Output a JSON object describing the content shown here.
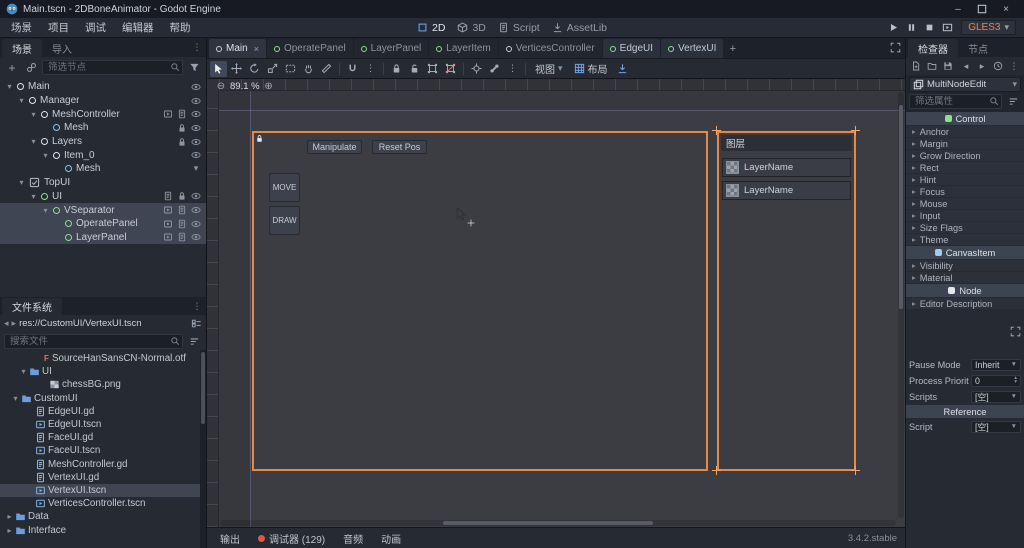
{
  "window": {
    "title": "Main.tscn - 2DBoneAnimator - Godot Engine"
  },
  "menubar": {
    "menus": [
      "场景",
      "项目",
      "调试",
      "编辑器",
      "帮助"
    ],
    "workspaces": [
      {
        "label": "2D",
        "active": true
      },
      {
        "label": "3D",
        "active": false
      },
      {
        "label": "Script",
        "active": false
      },
      {
        "label": "AssetLib",
        "active": false
      }
    ],
    "renderer": "GLES3"
  },
  "scene_dock": {
    "tabs": [
      {
        "label": "场景",
        "active": true
      },
      {
        "label": "导入",
        "active": false
      }
    ],
    "filter_placeholder": "筛选节点",
    "nodes": [
      {
        "name": "Main",
        "indent": 0,
        "arrow": true,
        "icon": "node",
        "color": "#dfe3e8",
        "buttons": [
          "eye"
        ],
        "selected": false
      },
      {
        "name": "Manager",
        "indent": 1,
        "arrow": true,
        "icon": "node",
        "color": "#dfe3e8",
        "buttons": [
          "eye"
        ],
        "selected": false
      },
      {
        "name": "MeshController",
        "indent": 2,
        "arrow": true,
        "icon": "node",
        "color": "#dfe3e8",
        "buttons": [
          "scene",
          "script",
          "eye"
        ],
        "selected": false
      },
      {
        "name": "Mesh",
        "indent": 3,
        "arrow": false,
        "icon": "node",
        "color": "#7fc7f0",
        "buttons": [
          "lock",
          "eye"
        ],
        "selected": false
      },
      {
        "name": "Layers",
        "indent": 2,
        "arrow": true,
        "icon": "node",
        "color": "#dfe3e8",
        "buttons": [
          "lock",
          "eye"
        ],
        "selected": false
      },
      {
        "name": "Item_0",
        "indent": 3,
        "arrow": true,
        "icon": "node",
        "color": "#dfe3e8",
        "buttons": [
          "eye"
        ],
        "selected": false
      },
      {
        "name": "Mesh",
        "indent": 4,
        "arrow": false,
        "icon": "node",
        "color": "#7fc7f0",
        "buttons": [
          "chev-down"
        ],
        "selected": false
      },
      {
        "name": "TopUI",
        "indent": 1,
        "arrow": true,
        "icon": "checkbox",
        "color": "#b9c0cb",
        "buttons": [],
        "selected": false
      },
      {
        "name": "UI",
        "indent": 2,
        "arrow": true,
        "icon": "node",
        "color": "#8ede8e",
        "buttons": [
          "script",
          "lock",
          "eye"
        ],
        "selected": false
      },
      {
        "name": "VSeparator",
        "indent": 3,
        "arrow": true,
        "icon": "node",
        "color": "#8ede8e",
        "buttons": [
          "scene",
          "script",
          "eye"
        ],
        "selected": true
      },
      {
        "name": "OperatePanel",
        "indent": 4,
        "arrow": false,
        "icon": "node",
        "color": "#8ede8e",
        "buttons": [
          "scene",
          "script",
          "eye"
        ],
        "selected": true
      },
      {
        "name": "LayerPanel",
        "indent": 4,
        "arrow": false,
        "icon": "node",
        "color": "#8ede8e",
        "buttons": [
          "scene",
          "script",
          "eye"
        ],
        "selected": true
      }
    ]
  },
  "filesystem": {
    "title": "文件系统",
    "path": "res://CustomUI/VertexUI.tscn",
    "search_placeholder": "搜索文件",
    "files": [
      {
        "name": "SourceHanSansCN-Normal.otf",
        "indent": 30,
        "icon": "font",
        "arrow": "",
        "selected": false
      },
      {
        "name": "UI",
        "indent": 18,
        "icon": "folder",
        "arrow": "down",
        "selected": false
      },
      {
        "name": "chessBG.png",
        "indent": 38,
        "icon": "image",
        "arrow": "",
        "selected": false
      },
      {
        "name": "CustomUI",
        "indent": 10,
        "icon": "folder",
        "arrow": "down",
        "selected": false
      },
      {
        "name": "EdgeUI.gd",
        "indent": 24,
        "icon": "script",
        "arrow": "",
        "selected": false
      },
      {
        "name": "EdgeUI.tscn",
        "indent": 24,
        "icon": "scene",
        "arrow": "",
        "selected": false
      },
      {
        "name": "FaceUI.gd",
        "indent": 24,
        "icon": "script",
        "arrow": "",
        "selected": false
      },
      {
        "name": "FaceUI.tscn",
        "indent": 24,
        "icon": "scene",
        "arrow": "",
        "selected": false
      },
      {
        "name": "MeshController.gd",
        "indent": 24,
        "icon": "script",
        "arrow": "",
        "selected": false
      },
      {
        "name": "VertexUI.gd",
        "indent": 24,
        "icon": "script",
        "arrow": "",
        "selected": false
      },
      {
        "name": "VertexUI.tscn",
        "indent": 24,
        "icon": "scene",
        "arrow": "",
        "selected": true
      },
      {
        "name": "VerticesController.tscn",
        "indent": 24,
        "icon": "scene",
        "arrow": "",
        "selected": false
      },
      {
        "name": "Data",
        "indent": 4,
        "icon": "folder",
        "arrow": "right",
        "selected": false
      },
      {
        "name": "Interface",
        "indent": 4,
        "icon": "folder",
        "arrow": "right",
        "selected": false
      }
    ]
  },
  "scene_tabs": {
    "tabs": [
      {
        "label": "Main",
        "icon_color": "#c7cdd6",
        "active": true,
        "highlighted": false
      },
      {
        "label": "OperatePanel",
        "icon_color": "#8ede8e",
        "active": false,
        "highlighted": false
      },
      {
        "label": "LayerPanel",
        "icon_color": "#8ede8e",
        "active": false,
        "highlighted": false
      },
      {
        "label": "LayerItem",
        "icon_color": "#8ede8e",
        "active": false,
        "highlighted": false
      },
      {
        "label": "VerticesController",
        "icon_color": "#c7cdd6",
        "active": false,
        "highlighted": false
      },
      {
        "label": "EdgeUI",
        "icon_color": "#8ede8e",
        "active": false,
        "highlighted": true
      },
      {
        "label": "VertexUI",
        "icon_color": "#8ede8e",
        "active": false,
        "highlighted": true
      }
    ]
  },
  "canvas_toolbar": {
    "tools": [
      {
        "icon": "select",
        "active": true
      },
      {
        "icon": "move"
      },
      {
        "icon": "rotate"
      },
      {
        "icon": "scale"
      },
      {
        "icon": "rectsel"
      },
      {
        "icon": "pan"
      },
      {
        "icon": "ruler"
      },
      {
        "sep": true
      },
      {
        "icon": "magnet"
      },
      {
        "icon": "dots"
      },
      {
        "sep": true
      },
      {
        "icon": "lock"
      },
      {
        "icon": "unlock"
      },
      {
        "icon": "group"
      },
      {
        "icon": "ungroup"
      },
      {
        "sep": true
      },
      {
        "icon": "pin"
      },
      {
        "icon": "bone"
      },
      {
        "icon": "dots"
      },
      {
        "sep": true
      }
    ],
    "view_label": "视图",
    "layout_label": "布局"
  },
  "canvas": {
    "zoom": "89.1 %",
    "buttons": {
      "manipulate": "Manipulate",
      "reset_pos": "Reset Pos",
      "move": "MOVE",
      "draw": "DRAW"
    },
    "layer_panel": {
      "title": "图层",
      "items": [
        {
          "label": "LayerName"
        },
        {
          "label": "LayerName"
        }
      ]
    }
  },
  "bottom_bar": {
    "items": [
      {
        "label": "输出",
        "badge": false
      },
      {
        "label": "调试器 (129)",
        "badge": true
      },
      {
        "label": "音频",
        "badge": false
      },
      {
        "label": "动画",
        "badge": false
      }
    ],
    "version": "3.4.2.stable"
  },
  "inspector": {
    "tabs": [
      {
        "label": "检查器",
        "active": true
      },
      {
        "label": "节点",
        "active": false
      }
    ],
    "object_name": "MultiNodeEdit",
    "filter_placeholder": "筛选属性",
    "rows": [
      {
        "type": "category",
        "label": "Control",
        "color": "#8ede8e"
      },
      {
        "type": "group",
        "label": "Anchor"
      },
      {
        "type": "group",
        "label": "Margin"
      },
      {
        "type": "group",
        "label": "Grow Direction"
      },
      {
        "type": "group",
        "label": "Rect"
      },
      {
        "type": "group",
        "label": "Hint"
      },
      {
        "type": "group",
        "label": "Focus"
      },
      {
        "type": "group",
        "label": "Mouse"
      },
      {
        "type": "group",
        "label": "Input"
      },
      {
        "type": "group",
        "label": "Size Flags"
      },
      {
        "type": "group",
        "label": "Theme"
      },
      {
        "type": "category",
        "label": "CanvasItem",
        "color": "#9ecbf2"
      },
      {
        "type": "group",
        "label": "Visibility"
      },
      {
        "type": "group",
        "label": "Material"
      },
      {
        "type": "category",
        "label": "Node",
        "color": "#e3e6eb"
      },
      {
        "type": "group",
        "label": "Editor Description"
      },
      {
        "type": "descbox"
      },
      {
        "type": "prop",
        "label": "Pause Mode",
        "value": "Inherit",
        "kind": "dropdown"
      },
      {
        "type": "prop",
        "label": "Process Priorit",
        "value": "0",
        "kind": "spin"
      },
      {
        "type": "prop",
        "label": "Scripts",
        "value": "[空]",
        "kind": "dropdown"
      },
      {
        "type": "category",
        "label": "Reference",
        "color": ""
      },
      {
        "type": "prop",
        "label": "Script",
        "value": "[空]",
        "kind": "dropdown"
      }
    ]
  }
}
